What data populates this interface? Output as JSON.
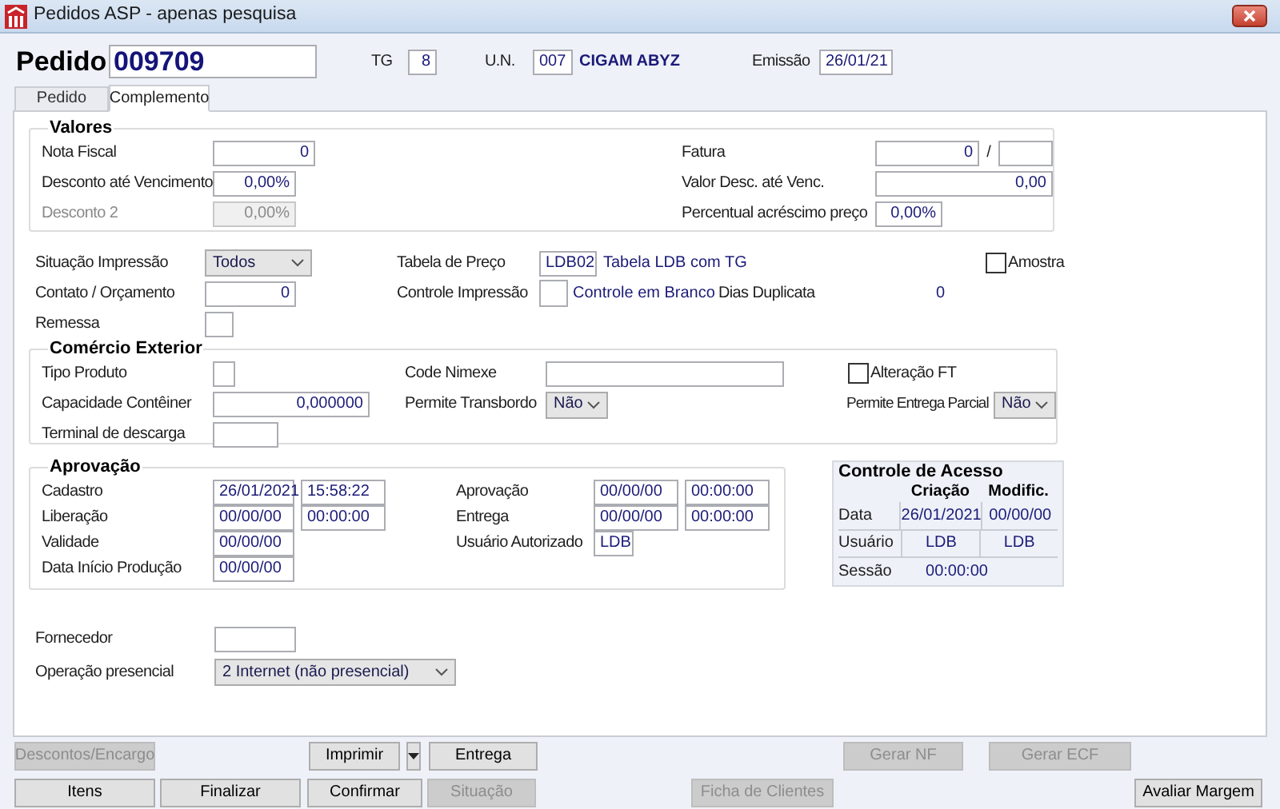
{
  "window": {
    "title": "Pedidos ASP - apenas pesquisa"
  },
  "header": {
    "label": "Pedido",
    "number": "009709",
    "tg_label": "TG",
    "tg": "8",
    "un_label": "U.N.",
    "un": "007",
    "un_name": "CIGAM ABYZ",
    "emissao_label": "Emissão",
    "emissao": "26/01/21"
  },
  "tabs": [
    {
      "label": "Pedido",
      "selected": false
    },
    {
      "label": "Complemento",
      "selected": true
    }
  ],
  "valores": {
    "title": "Valores",
    "left": [
      {
        "label": "Nota Fiscal",
        "value": "0",
        "disabled": false
      },
      {
        "label": "Desconto até Vencimento",
        "value": "0,00%",
        "disabled": false
      },
      {
        "label": "Desconto 2",
        "value": "0,00%",
        "disabled": true
      }
    ],
    "fatura": {
      "label": "Fatura",
      "value": "0",
      "separator": "/"
    },
    "valor_desc": {
      "label": "Valor Desc. até Venc.",
      "value": "0,00"
    },
    "percentual": {
      "label": "Percentual acréscimo preço",
      "value": "0,00%"
    }
  },
  "situacao_impressao": {
    "label": "Situação Impressão",
    "value": "Todos"
  },
  "tabela_preco": {
    "label": "Tabela de Preço",
    "value": "LDB02",
    "description": "Tabela LDB com TG"
  },
  "amostra": {
    "label": "Amostra",
    "checked": false
  },
  "contato": {
    "label": "Contato / Orçamento",
    "value": "0"
  },
  "controle_impressao": {
    "label": "Controle Impressão",
    "description": "Controle em Branco"
  },
  "dias_duplicata": {
    "label": "Dias Duplicata",
    "value": "0"
  },
  "remessa": {
    "label": "Remessa"
  },
  "comercio_exterior": {
    "title": "Comércio Exterior",
    "tipo_produto": {
      "label": "Tipo Produto"
    },
    "code_nimexe": {
      "label": "Code Nimexe"
    },
    "alteracao_ft": {
      "label": "Alteração FT",
      "checked": false
    },
    "capacidade": {
      "label": "Capacidade Contêiner",
      "value": "0,000000"
    },
    "transbordo": {
      "label": "Permite Transbordo",
      "value": "Não"
    },
    "entrega_parcial": {
      "label": "Permite Entrega Parcial",
      "value": "Não"
    },
    "terminal": {
      "label": "Terminal de descarga"
    }
  },
  "aprovacao": {
    "title": "Aprovação",
    "left": [
      {
        "label": "Cadastro",
        "values": [
          "26/01/2021",
          "15:58:22"
        ]
      },
      {
        "label": "Liberação",
        "values": [
          "00/00/00",
          "00:00:00"
        ]
      },
      {
        "label": "Validade",
        "values": [
          "00/00/00"
        ]
      },
      {
        "label": "Data Início Produção",
        "values": [
          "00/00/00"
        ]
      }
    ],
    "right": [
      {
        "label": "Aprovação",
        "kind": "datetime",
        "values": [
          "00/00/00",
          "00:00:00"
        ]
      },
      {
        "label": "Entrega",
        "kind": "datetime",
        "values": [
          "00/00/00",
          "00:00:00"
        ]
      },
      {
        "label": "Usuário Autorizado",
        "kind": "code",
        "values": [
          "LDB"
        ]
      }
    ]
  },
  "controle_acesso": {
    "title": "Controle de Acesso",
    "columns": [
      "Criação",
      "Modific."
    ],
    "rows": [
      {
        "label": "Data",
        "values": [
          "26/01/2021",
          "00/00/00"
        ]
      },
      {
        "label": "Usuário",
        "values": [
          "LDB",
          "LDB"
        ]
      }
    ],
    "sessao": {
      "label": "Sessão",
      "value": "00:00:00"
    }
  },
  "fornecedor": {
    "label": "Fornecedor"
  },
  "operacao": {
    "label": "Operação presencial",
    "value": "2 Internet (não presencial)"
  },
  "buttons_row1": [
    {
      "kind": "text",
      "label": "Descontos/Encargo",
      "disabled": true
    },
    {
      "kind": "text",
      "label": "Imprimir",
      "disabled": false
    },
    {
      "kind": "dropdown",
      "disabled": false
    },
    {
      "kind": "text",
      "label": "Entrega",
      "disabled": false
    },
    {
      "kind": "text",
      "label": "Gerar NF",
      "disabled": true
    },
    {
      "kind": "text",
      "label": "Gerar ECF",
      "disabled": true
    }
  ],
  "buttons_row2": [
    {
      "kind": "text",
      "label": "Itens",
      "disabled": false
    },
    {
      "kind": "text",
      "label": "Finalizar",
      "disabled": false
    },
    {
      "kind": "text",
      "label": "Confirmar",
      "disabled": false
    },
    {
      "kind": "text",
      "label": "Situação",
      "disabled": true
    },
    {
      "kind": "text",
      "label": "Ficha de Clientes",
      "disabled": true
    },
    {
      "kind": "text",
      "label": "Avaliar Margem",
      "disabled": false
    }
  ]
}
